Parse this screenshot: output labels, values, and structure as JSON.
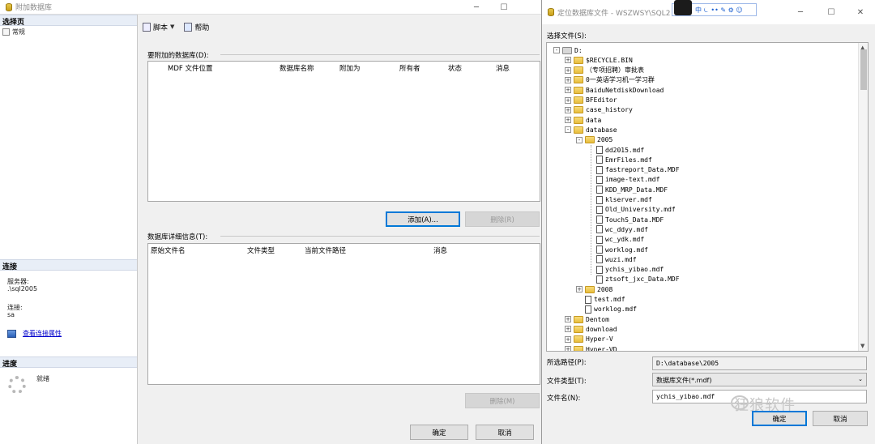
{
  "attach_window": {
    "title": "附加数据库",
    "select_page_label": "选择页",
    "pages": [
      "常规"
    ],
    "toolbar": {
      "script_label": "脚本",
      "help_label": "帮助"
    },
    "databases_to_attach_label": "要附加的数据库(D):",
    "db_columns": [
      "MDF 文件位置",
      "数据库名称",
      "附加为",
      "所有者",
      "状态",
      "消息"
    ],
    "add_button": "添加(A)...",
    "remove_button": "删除(R)",
    "details_label": "数据库详细信息(T):",
    "detail_columns": [
      "原始文件名",
      "文件类型",
      "当前文件路径",
      "消息"
    ],
    "remove_button2": "删除(M)",
    "ok_button": "确定",
    "cancel_button": "取消",
    "connection": {
      "header": "连接",
      "server_label": "服务器:",
      "server_value": ".\\sql2005",
      "conn_label": "连接:",
      "conn_value": "sa",
      "view_props_link": "查看连接属性"
    },
    "progress": {
      "header": "进度",
      "status": "就绪"
    }
  },
  "locate_dialog": {
    "title": "定位数据库文件 - WSZWSY\\SQL2",
    "overlay_toolbar_text": "中 ⏾ •• ✎ ⚙ ☺",
    "select_file_label": "选择文件(S):",
    "tree": [
      {
        "label": "D:",
        "type": "drive",
        "level": 0,
        "expander": "-"
      },
      {
        "label": "$RECYCLE.BIN",
        "type": "folder",
        "level": 1,
        "expander": "+"
      },
      {
        "label": "（专项招聘）审批表",
        "type": "folder",
        "level": 1,
        "expander": "+"
      },
      {
        "label": "0一英语学习机一学习群",
        "type": "folder",
        "level": 1,
        "expander": "+"
      },
      {
        "label": "BaiduNetdiskDownload",
        "type": "folder",
        "level": 1,
        "expander": "+"
      },
      {
        "label": "BFEditor",
        "type": "folder",
        "level": 1,
        "expander": "+"
      },
      {
        "label": "case_history",
        "type": "folder",
        "level": 1,
        "expander": "+"
      },
      {
        "label": "data",
        "type": "folder",
        "level": 1,
        "expander": "+"
      },
      {
        "label": "database",
        "type": "folder",
        "level": 1,
        "expander": "-"
      },
      {
        "label": "2005",
        "type": "folder",
        "level": 2,
        "expander": "-"
      },
      {
        "label": "dd2015.mdf",
        "type": "file",
        "level": 3
      },
      {
        "label": "EmrFiles.mdf",
        "type": "file",
        "level": 3
      },
      {
        "label": "fastreport_Data.MDF",
        "type": "file",
        "level": 3
      },
      {
        "label": "image-text.mdf",
        "type": "file",
        "level": 3
      },
      {
        "label": "KDD_MRP_Data.MDF",
        "type": "file",
        "level": 3
      },
      {
        "label": "klserver.mdf",
        "type": "file",
        "level": 3
      },
      {
        "label": "Old_University.mdf",
        "type": "file",
        "level": 3
      },
      {
        "label": "TouchS_Data.MDF",
        "type": "file",
        "level": 3
      },
      {
        "label": "wc_ddyy.mdf",
        "type": "file",
        "level": 3
      },
      {
        "label": "wc_ydk.mdf",
        "type": "file",
        "level": 3
      },
      {
        "label": "worklog.mdf",
        "type": "file",
        "level": 3
      },
      {
        "label": "wuzi.mdf",
        "type": "file",
        "level": 3
      },
      {
        "label": "ychis_yibao.mdf",
        "type": "file",
        "level": 3
      },
      {
        "label": "ztsoft_jxc_Data.MDF",
        "type": "file",
        "level": 3
      },
      {
        "label": "2008",
        "type": "folder",
        "level": 2,
        "expander": "+"
      },
      {
        "label": "test.mdf",
        "type": "file",
        "level": 2
      },
      {
        "label": "worklog.mdf",
        "type": "file",
        "level": 2
      },
      {
        "label": "Dentom",
        "type": "folder",
        "level": 1,
        "expander": "+"
      },
      {
        "label": "download",
        "type": "folder",
        "level": 1,
        "expander": "+"
      },
      {
        "label": "Hyper-V",
        "type": "folder",
        "level": 1,
        "expander": "+"
      },
      {
        "label": "Hyper-VD",
        "type": "folder",
        "level": 1,
        "expander": "+"
      }
    ],
    "selected_path_label": "所选路径(P):",
    "selected_path_value": "D:\\database\\2005",
    "file_type_label": "文件类型(T):",
    "file_type_value": "数据库文件(*.mdf)",
    "file_name_label": "文件名(N):",
    "file_name_value": "ychis_yibao.mdf",
    "ok_button": "确定",
    "cancel_button": "取消"
  },
  "watermark_text": "狂狼软件"
}
